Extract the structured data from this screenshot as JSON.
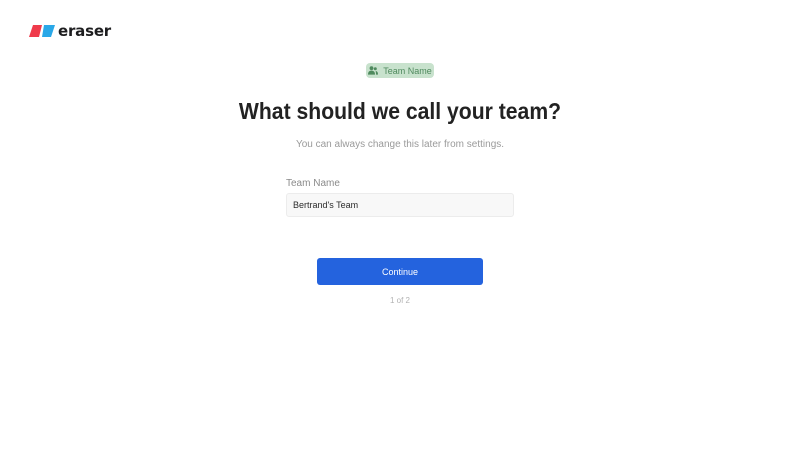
{
  "brand": {
    "name": "eraser",
    "colors": {
      "red": "#ef3a4b",
      "blue": "#2aa8e8"
    },
    "icon": "eraser-logo-mark"
  },
  "step_badge": {
    "icon": "team-users-icon",
    "label": "Team Name",
    "bg_color": "#c8e2cd",
    "text_color": "#4f8a5e"
  },
  "heading": {
    "title": "What should we call your team?",
    "subtitle": "You can always change this later from settings."
  },
  "form": {
    "team_name_label": "Team Name",
    "team_name_value": "Bertrand's Team"
  },
  "actions": {
    "continue_label": "Continue",
    "accent_color": "#2463de"
  },
  "progress": {
    "text": "1 of 2"
  }
}
